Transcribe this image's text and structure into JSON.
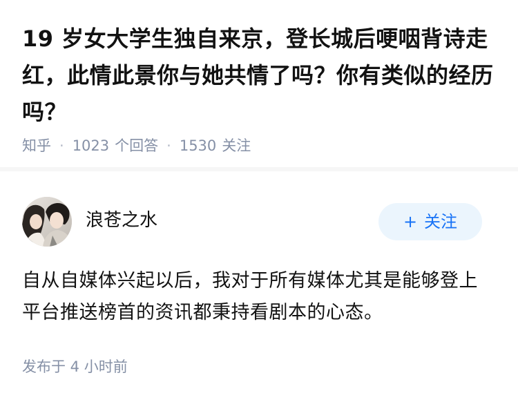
{
  "question": {
    "title": "19 岁女大学生独自来京，登长城后哽咽背诗走红，此情此景你与她共情了吗？你有类似的经历吗？",
    "source": "知乎",
    "separator": "·",
    "answer_count": "1023",
    "answer_label": "个回答",
    "follower_count": "1530",
    "follower_label": "关注"
  },
  "answer": {
    "author_name": "浪苍之水",
    "follow_plus": "+",
    "follow_label": "关注",
    "content": "自从自媒体兴起以后，我对于所有媒体尤其是能够登上平台推送榜首的资讯都秉持看剧本的心态。",
    "published_time": "发布于  4 小时前"
  },
  "colors": {
    "accent": "#1772f6",
    "follow_bg": "#ebf5fd",
    "meta_gray": "#8590a6",
    "text": "#121212",
    "divider": "#f6f6f6"
  },
  "icons": {
    "avatar": "author-avatar-photo"
  }
}
